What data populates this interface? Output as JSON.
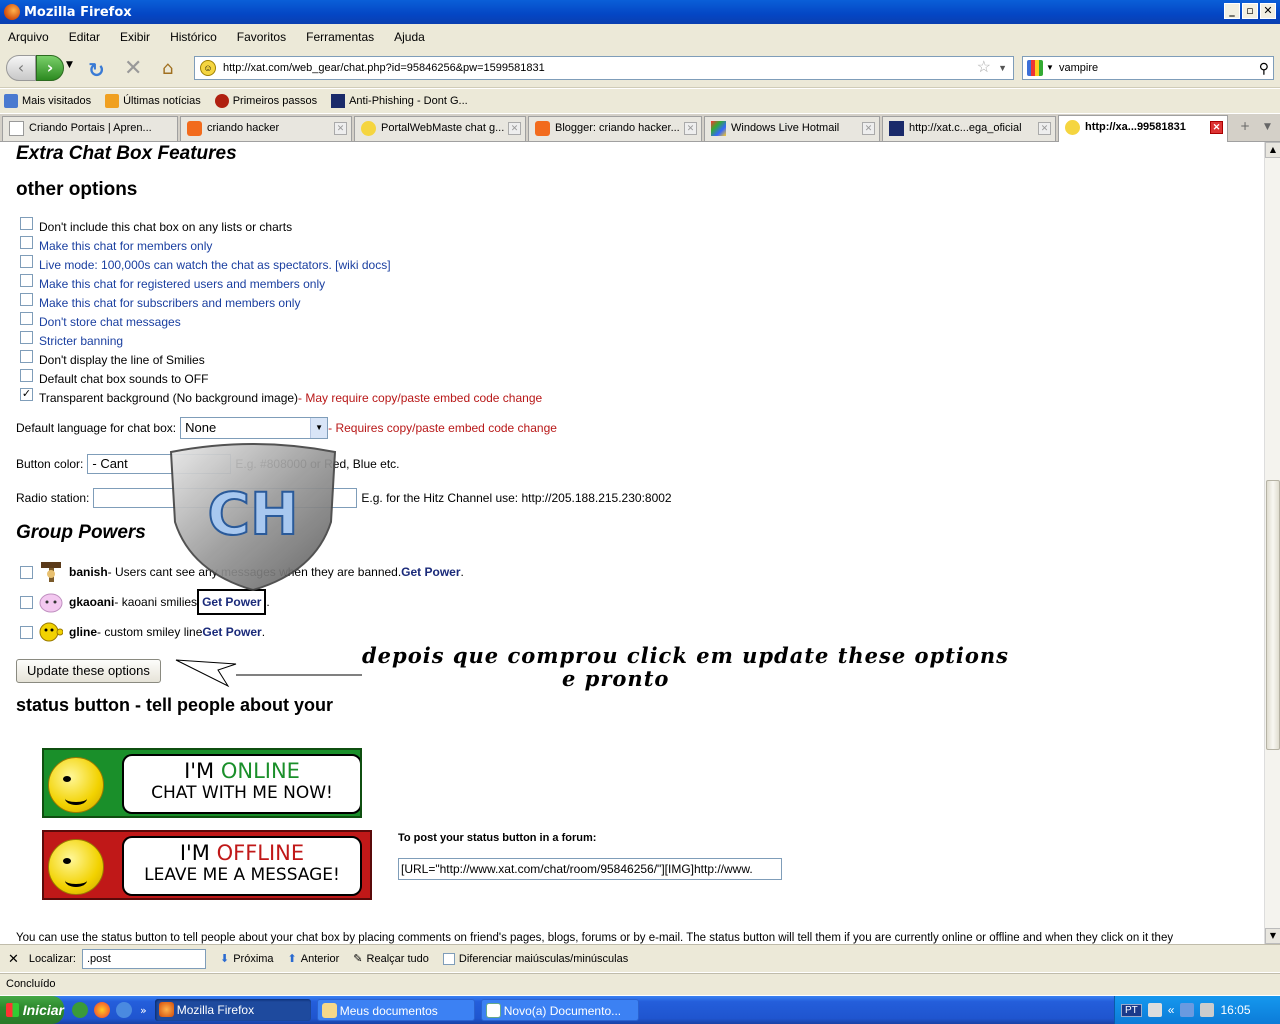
{
  "window": {
    "title": "Mozilla Firefox"
  },
  "menu": [
    "Arquivo",
    "Editar",
    "Exibir",
    "Histórico",
    "Favoritos",
    "Ferramentas",
    "Ajuda"
  ],
  "address": {
    "url": "http://xat.com/web_gear/chat.php?id=95846256&pw=1599581831"
  },
  "search": {
    "value": "vampire"
  },
  "bookmarks": [
    "Mais visitados",
    "Últimas notícias",
    "Primeiros passos",
    "Anti-Phishing - Dont G..."
  ],
  "tabs": [
    "Criando Portais | Apren...",
    "criando hacker",
    "PortalWebMaste chat g...",
    "Blogger: criando hacker...",
    "Windows Live Hotmail",
    "http://xat.c...ega_oficial",
    "http://xa...99581831"
  ],
  "page": {
    "heading_features": "Extra Chat Box Features",
    "heading_other": "other options",
    "options": [
      {
        "label": "Don't include this chat box on any lists or charts",
        "checked": false,
        "color": "black"
      },
      {
        "label": "Make this chat for members only",
        "checked": false,
        "color": "blue"
      },
      {
        "label": "Live mode: 100,000s can watch the chat as spectators. [wiki docs]",
        "checked": false,
        "color": "blue"
      },
      {
        "label": "Make this chat for registered users and members only",
        "checked": false,
        "color": "blue"
      },
      {
        "label": "Make this chat for subscribers and members only",
        "checked": false,
        "color": "blue"
      },
      {
        "label": "Don't store chat messages",
        "checked": false,
        "color": "blue"
      },
      {
        "label": "Stricter banning",
        "checked": false,
        "color": "blue"
      },
      {
        "label": "Don't display the line of Smilies",
        "checked": false,
        "color": "black"
      },
      {
        "label": "Default chat box sounds to OFF",
        "checked": false,
        "color": "black"
      },
      {
        "label": "Transparent background (No background image)",
        "checked": true,
        "color": "black",
        "note": " - May require copy/paste embed code change"
      }
    ],
    "language_label": "Default language for chat box:",
    "language_value": "None",
    "language_note": " - Requires copy/paste embed code change",
    "button_color_label": "Button color:",
    "button_color_value": "- Cant",
    "button_color_hint": "E.g. #808000 or Red, Blue etc.",
    "radio_label": "Radio station:",
    "radio_hint": "E.g. for the Hitz Channel use: http://205.188.215.230:8002",
    "heading_powers": "Group Powers",
    "powers": [
      {
        "name": "banish",
        "desc": " - Users cant see any messages when they are banned. ",
        "link": "Get Power"
      },
      {
        "name": "gkaoani",
        "desc": " - kaoani smilies ",
        "link": "Get Power"
      },
      {
        "name": "gline",
        "desc": " - custom smiley line ",
        "link": "Get Power"
      }
    ],
    "update_button": "Update these options",
    "annotation_line1": "depois que comprou click em update these options",
    "annotation_line2": "e pronto",
    "logo_text": "CH",
    "heading_status": "status button - tell people about your",
    "online_line1_a": "I'M ",
    "online_line1_b": "ONLINE",
    "online_line2": "CHAT WITH ME NOW!",
    "offline_line1_a": "I'M ",
    "offline_line1_b": "OFFLINE",
    "offline_line2": "LEAVE ME A MESSAGE!",
    "post_label": "To post your status button in a forum:",
    "post_value": "[URL=\"http://www.xat.com/chat/room/95846256/\"][IMG]http://www.",
    "bottom_text": "You can use the status button to tell people about your chat box by placing comments on friend's pages, blogs, forums or by e-mail. The status button will tell them if you are currently online or offline and when they click on it they"
  },
  "findbar": {
    "label": "Localizar:",
    "value": ".post",
    "next": "Próxima",
    "prev": "Anterior",
    "highlight": "Realçar tudo",
    "match_case": "Diferenciar maiúsculas/minúsculas"
  },
  "status": "Concluído",
  "taskbar": {
    "start": "Iniciar",
    "tasks": [
      "Mozilla Firefox",
      "Meus documentos",
      "Novo(a) Documento..."
    ],
    "lang": "PT",
    "clock": "16:05"
  }
}
